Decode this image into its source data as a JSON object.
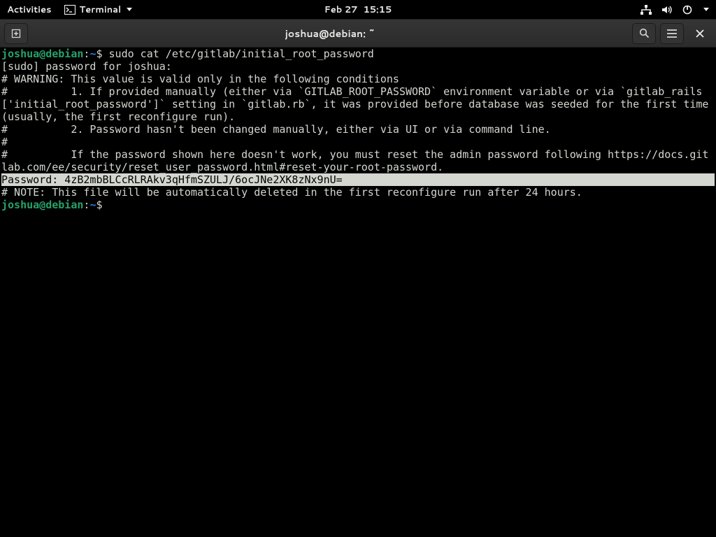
{
  "topbar": {
    "activities_label": "Activities",
    "app_label": "Terminal",
    "date_label": "Feb 27",
    "time_label": "15:15"
  },
  "titlebar": {
    "title": "joshua@debian: ~"
  },
  "terminal": {
    "prompt1_user": "joshua@debian",
    "prompt1_colon": ":",
    "prompt1_path": "~",
    "prompt1_dollar": "$ ",
    "command1": "sudo cat /etc/gitlab/initial_root_password",
    "sudo_prompt": "[sudo] password for joshua:",
    "warn1": "# WARNING: This value is valid only in the following conditions",
    "warn2": "#          1. If provided manually (either via `GITLAB_ROOT_PASSWORD` environment variable or via `gitlab_rails['initial_root_password']` setting in `gitlab.rb`, it was provided before database was seeded for the first time (usually, the first reconfigure run).",
    "warn3": "#          2. Password hasn't been changed manually, either via UI or via command line.",
    "warn4": "#",
    "warn5": "#          If the password shown here doesn't work, you must reset the admin password following https://docs.gitlab.com/ee/security/reset_user_password.html#reset-your-root-password.",
    "blank": "",
    "password_line": "Password: 4zB2mbBLCcRLRAkv3qHfmSZULJ/6ocJNe2XK8zNx9nU=",
    "note": "# NOTE: This file will be automatically deleted in the first reconfigure run after 24 hours.",
    "prompt2_user": "joshua@debian",
    "prompt2_colon": ":",
    "prompt2_path": "~",
    "prompt2_dollar": "$ "
  }
}
